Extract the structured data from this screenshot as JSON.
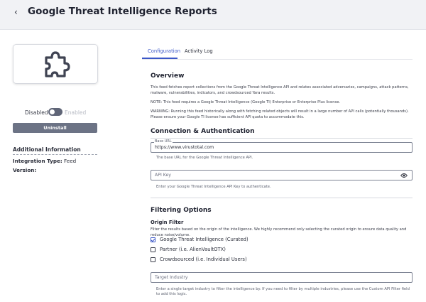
{
  "header": {
    "back_icon": "‹",
    "title": "Google Threat Intelligence Reports"
  },
  "sidebar": {
    "logo_icon": "puzzle-piece-icon",
    "toggle": {
      "off_label": "Disabled",
      "on_label": "Enabled",
      "state": "disabled"
    },
    "uninstall_label": "Uninstall",
    "additional_info": {
      "title": "Additional Information",
      "integration_type_label": "Integration Type:",
      "integration_type_value": "Feed",
      "version_label": "Version:",
      "version_value": ""
    }
  },
  "tabs": {
    "items": [
      {
        "label": "Configuration",
        "active": true
      },
      {
        "label": "Activity Log",
        "active": false
      }
    ],
    "accent": "#3b57c7"
  },
  "overview": {
    "title": "Overview",
    "para1": "This feed fetches report collections from the Google Threat Intelligence API and relates associated adversaries, campaigns, attack patterns, malware, vulnerabilities, indicators, and crowdsourced Yara results.",
    "para2": "NOTE: This feed requires a Google Threat Intelligence (Google TI) Enterprise or Enterprise Plus license.",
    "para3": "WARNING: Running this feed historically along with fetching related objects will result in a large number of API calls (potentially thousands). Please ensure your Google TI license has sufficient API quota to accommodate this."
  },
  "connection": {
    "title": "Connection & Authentication",
    "base_url": {
      "legend": "Base URL",
      "value": "https://www.virustotal.com",
      "help": "The base URL for the Google Threat Intelligence API."
    },
    "api_key": {
      "placeholder": "API Key",
      "help": "Enter your Google Threat Intelligence API Key to authenticate.",
      "icon": "eye-icon"
    }
  },
  "filtering": {
    "title": "Filtering Options",
    "origin_filter": {
      "title": "Origin Filter",
      "description": "Filter the results based on the origin of the intelligence. We highly recommend only selecting the curated origin to ensure data quality and reduce noise/volume.",
      "options": [
        {
          "label": "Google Threat Intelligence (Curated)",
          "checked": true
        },
        {
          "label": "Partner (i.e. AlienVaultOTX)",
          "checked": false
        },
        {
          "label": "Crowdsourced (i.e. Individual Users)",
          "checked": false
        }
      ]
    },
    "target_industry": {
      "placeholder": "Target Industry",
      "help": "Enter a single target industry to filter the intelligence by. If you need to filter by multiple industries, please use the Custom API Filter field to add this logic."
    }
  }
}
